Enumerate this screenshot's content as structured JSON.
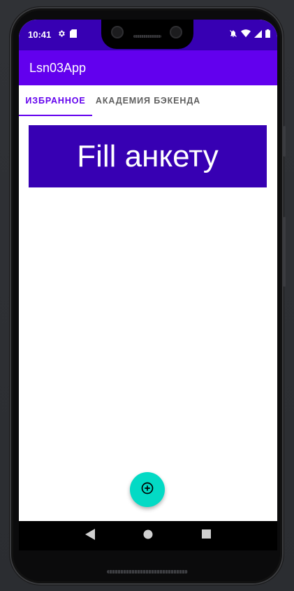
{
  "status_bar": {
    "time": "10:41",
    "left_icons": [
      "gear-icon",
      "sd-card-icon"
    ],
    "right_icons": [
      "notifications-off-icon",
      "wifi-icon",
      "signal-icon",
      "battery-icon"
    ]
  },
  "app_bar": {
    "title": "Lsn03App"
  },
  "tabs": [
    {
      "label": "ИЗБРАННОЕ",
      "selected": true
    },
    {
      "label": "АКАДЕМИЯ БЭКЕНДА",
      "selected": false
    }
  ],
  "content": {
    "fill_button_label": "Fill анкету"
  },
  "fab": {
    "icon": "add-circle-icon"
  },
  "nav_bar": {
    "buttons": [
      "back-icon",
      "home-icon",
      "recents-icon"
    ]
  },
  "colors": {
    "primary": "#6200ee",
    "primary_dark": "#3700b3",
    "accent": "#03dac5"
  }
}
